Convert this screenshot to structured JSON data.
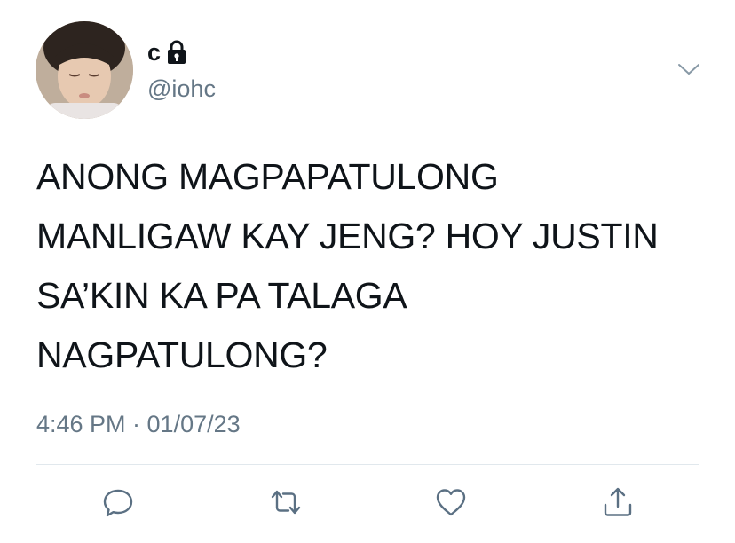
{
  "user": {
    "display_name": "c",
    "handle": "@iohc",
    "protected_icon": "lock-icon",
    "avatar_icon": "avatar-photo"
  },
  "menu": {
    "more_icon": "chevron-down-icon"
  },
  "tweet": {
    "lines": [
      "ANONG MAGPAPATULONG",
      "MANLIGAW KAY JENG? HOY JUSTIN",
      "SA’KIN KA PA TALAGA",
      "NAGPATULONG?"
    ],
    "timestamp": "4:46 PM · 01/07/23"
  },
  "actions": {
    "reply_icon": "reply-icon",
    "retweet_icon": "retweet-icon",
    "like_icon": "heart-icon",
    "share_icon": "share-icon"
  },
  "colors": {
    "text_primary": "#0f1419",
    "text_secondary": "#657786",
    "divider": "#e1e8ed",
    "action_icon": "#5b7083"
  }
}
